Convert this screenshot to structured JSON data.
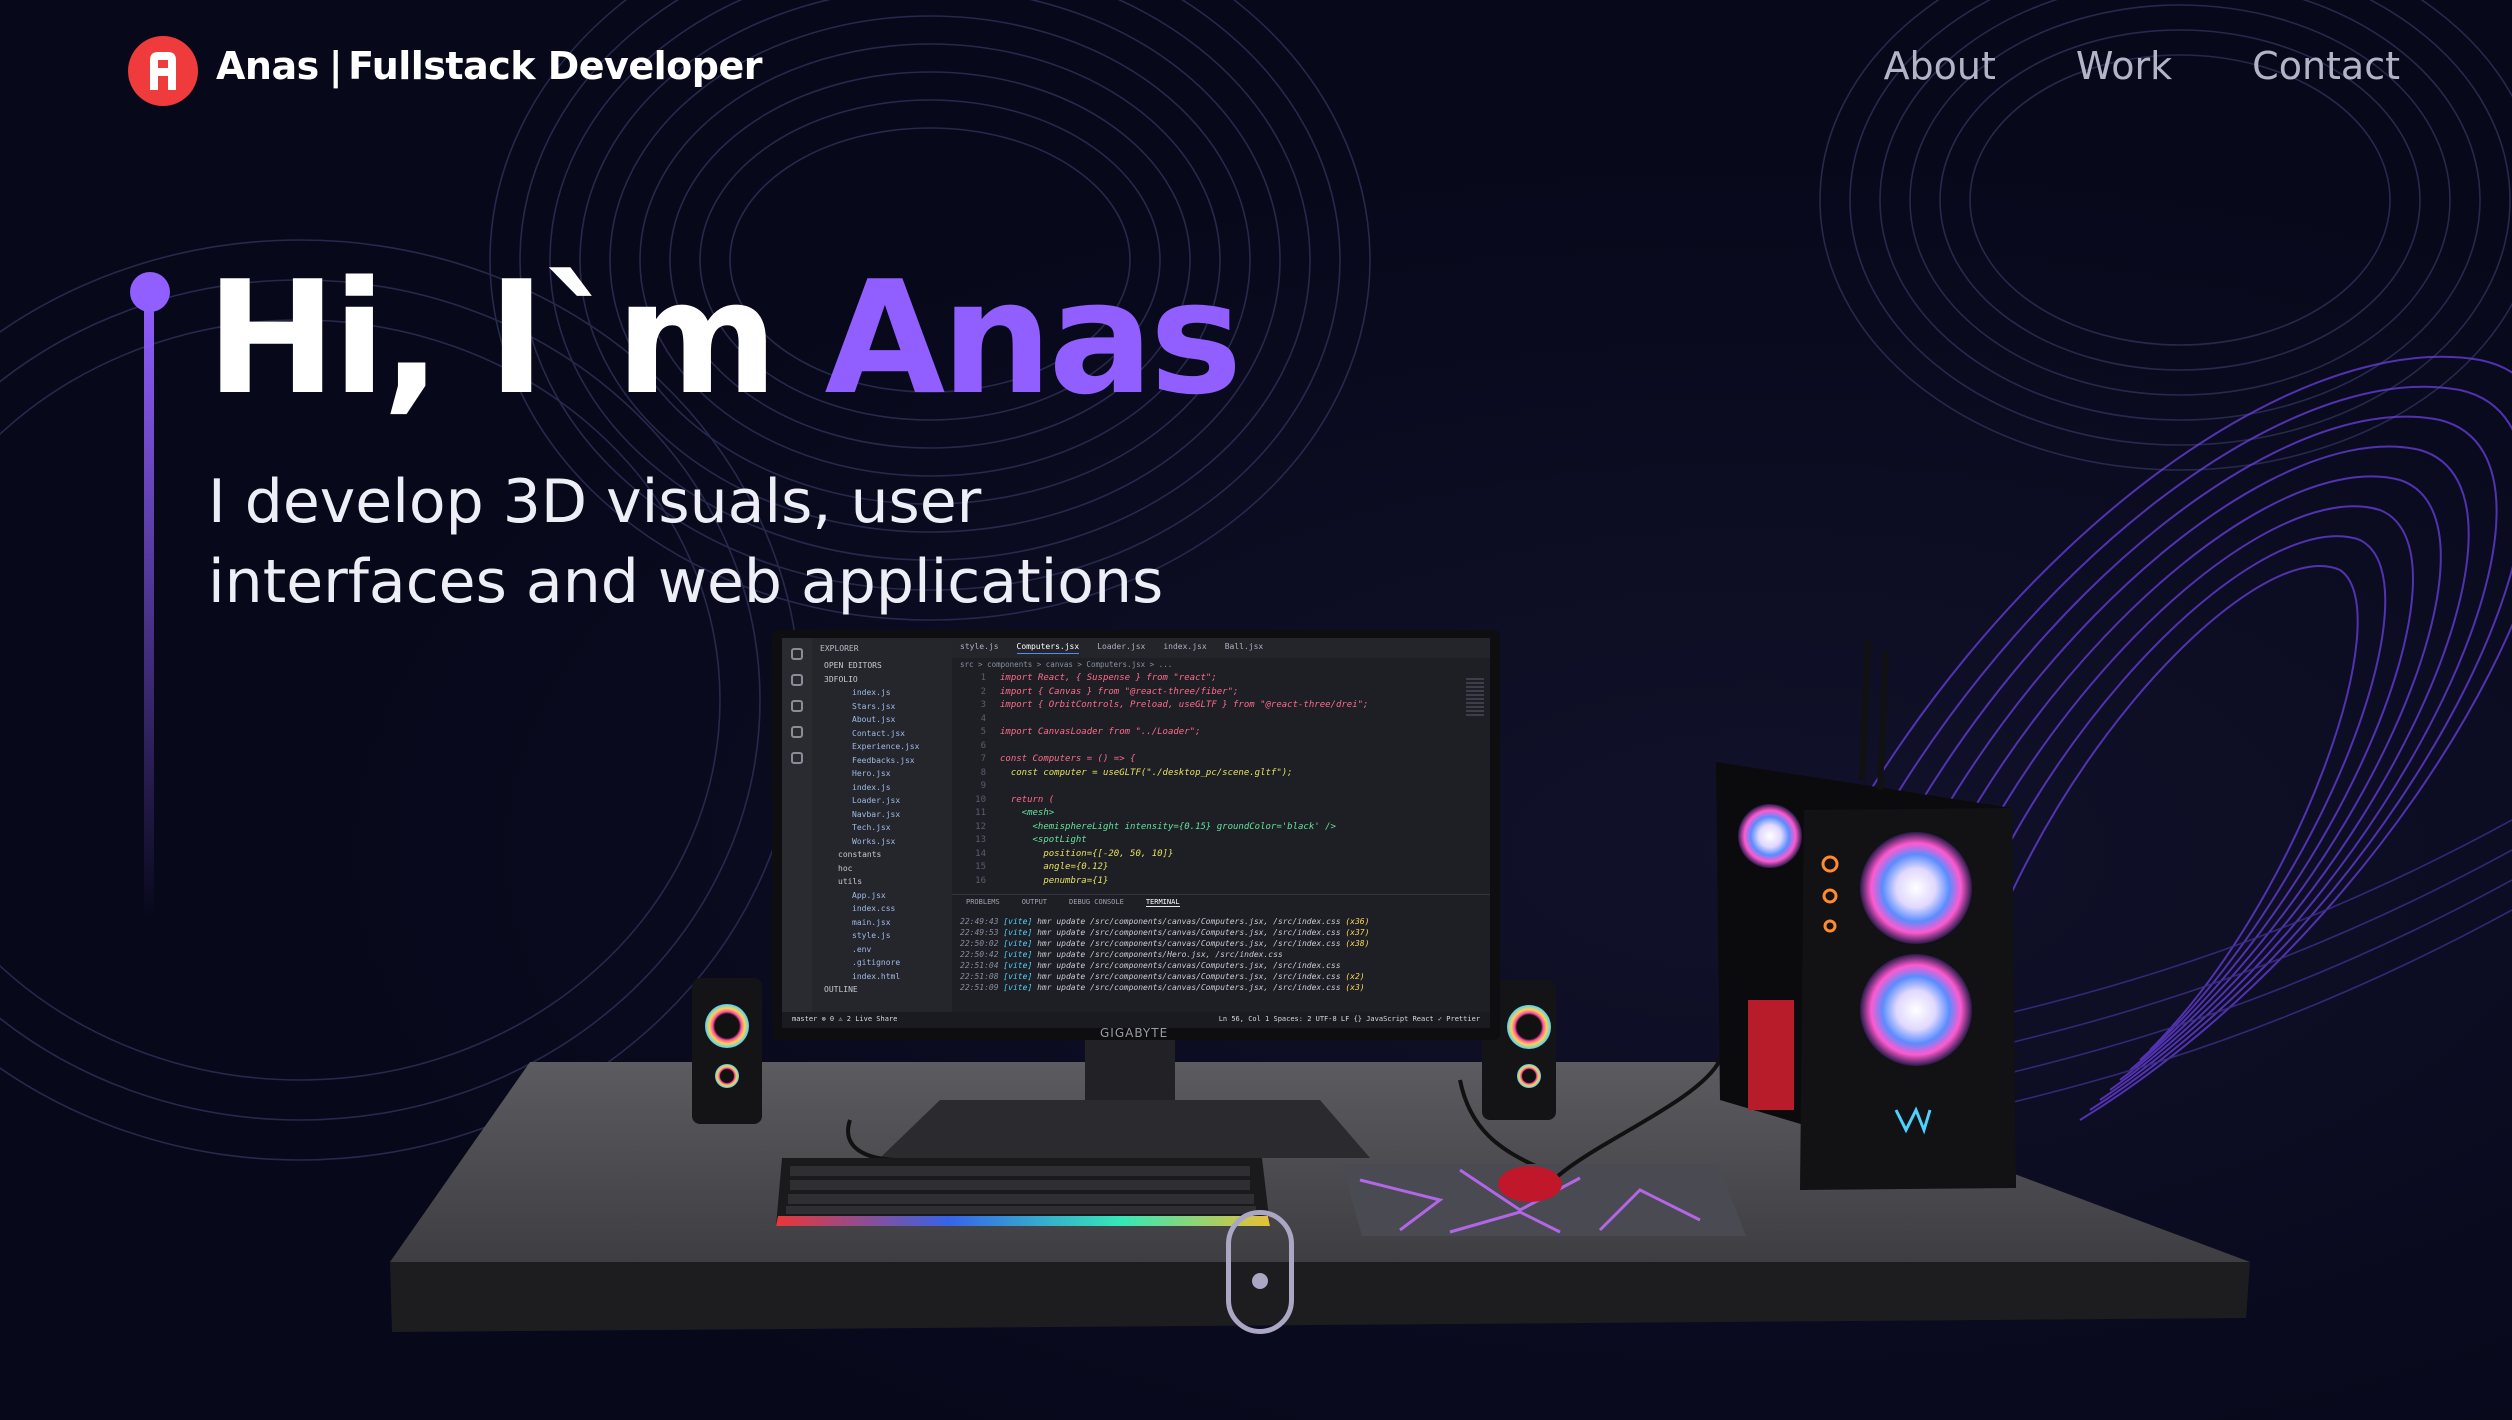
{
  "navbar": {
    "logo_letter": "A",
    "brand_name": "Anas",
    "brand_separator": "|",
    "brand_title": "Fullstack Developer",
    "links": [
      {
        "label": "About"
      },
      {
        "label": "Work"
      },
      {
        "label": "Contact"
      }
    ]
  },
  "hero": {
    "greeting": "Hi, I`m",
    "name": "Anas",
    "subtitle_line1": "I develop 3D visuals, user",
    "subtitle_line2": "interfaces and web applications"
  },
  "colors": {
    "background": "#07081a",
    "accent": "#915eff",
    "logo_red": "#ef3b3b",
    "nav_text": "#b4b4c8"
  },
  "editor": {
    "explorer_title": "EXPLORER",
    "open_editors": "OPEN EDITORS",
    "project": "3DFOLIO",
    "files": [
      "index.js",
      "Stars.jsx",
      "About.jsx",
      "Contact.jsx",
      "Experience.jsx",
      "Feedbacks.jsx",
      "Hero.jsx",
      "index.js",
      "Loader.jsx",
      "Navbar.jsx",
      "Tech.jsx",
      "Works.jsx"
    ],
    "folders": [
      "constants",
      "hoc",
      "utils"
    ],
    "root_files": [
      "App.jsx",
      "index.css",
      "main.jsx",
      "style.js",
      ".env",
      ".gitignore",
      "index.html"
    ],
    "outline": "OUTLINE",
    "tabs": [
      "style.js",
      "Computers.jsx",
      "Loader.jsx",
      "index.jsx",
      "Ball.jsx"
    ],
    "breadcrumb": "src > components > canvas > Computers.jsx > ...",
    "code_lines": [
      {
        "n": "1",
        "t": "import React, { Suspense } from \"react\";",
        "c": "kw"
      },
      {
        "n": "2",
        "t": "import { Canvas } from \"@react-three/fiber\";",
        "c": "kw"
      },
      {
        "n": "3",
        "t": "import { OrbitControls, Preload, useGLTF } from \"@react-three/drei\";",
        "c": "kw"
      },
      {
        "n": "4",
        "t": "",
        "c": "wh"
      },
      {
        "n": "5",
        "t": "import CanvasLoader from \"../Loader\";",
        "c": "kw"
      },
      {
        "n": "6",
        "t": "",
        "c": "wh"
      },
      {
        "n": "7",
        "t": "const Computers = () => {",
        "c": "kw"
      },
      {
        "n": "8",
        "t": "  const computer = useGLTF(\"./desktop_pc/scene.gltf\");",
        "c": "tx"
      },
      {
        "n": "9",
        "t": "",
        "c": "wh"
      },
      {
        "n": "10",
        "t": "  return (",
        "c": "kw"
      },
      {
        "n": "11",
        "t": "    <mesh>",
        "c": "gr"
      },
      {
        "n": "12",
        "t": "      <hemisphereLight intensity={0.15} groundColor='black' />",
        "c": "gr"
      },
      {
        "n": "13",
        "t": "      <spotLight",
        "c": "gr"
      },
      {
        "n": "14",
        "t": "        position={[-20, 50, 10]}",
        "c": "tx"
      },
      {
        "n": "15",
        "t": "        angle={0.12}",
        "c": "tx"
      },
      {
        "n": "16",
        "t": "        penumbra={1}",
        "c": "tx"
      }
    ],
    "panel_tabs": [
      "PROBLEMS",
      "OUTPUT",
      "DEBUG CONSOLE",
      "TERMINAL"
    ],
    "terminal_lines": [
      {
        "time": "22:49:43",
        "msg": "hmr update /src/components/canvas/Computers.jsx, /src/index.css",
        "count": "(x36)"
      },
      {
        "time": "22:49:53",
        "msg": "hmr update /src/components/canvas/Computers.jsx, /src/index.css",
        "count": "(x37)"
      },
      {
        "time": "22:50:02",
        "msg": "hmr update /src/components/canvas/Computers.jsx, /src/index.css",
        "count": "(x38)"
      },
      {
        "time": "22:50:42",
        "msg": "hmr update /src/components/Hero.jsx, /src/index.css",
        "count": ""
      },
      {
        "time": "22:51:04",
        "msg": "hmr update /src/components/canvas/Computers.jsx, /src/index.css",
        "count": ""
      },
      {
        "time": "22:51:08",
        "msg": "hmr update /src/components/canvas/Computers.jsx, /src/index.css",
        "count": "(x2)"
      },
      {
        "time": "22:51:09",
        "msg": "hmr update /src/components/canvas/Computers.jsx, /src/index.css",
        "count": "(x3)"
      }
    ],
    "vite_tag": "[vite]",
    "status_left": "master  ⊗ 0 ⚠ 2   Live Share",
    "status_right": "Ln 56, Col 1  Spaces: 2  UTF-8  LF  {} JavaScript React  ✓ Prettier"
  },
  "monitor_brand": "GIGABYTE"
}
